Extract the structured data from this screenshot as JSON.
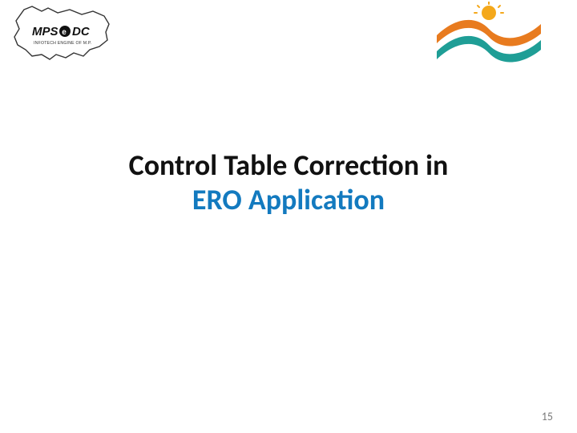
{
  "logos": {
    "left_alt": "MPSeDC logo",
    "right_alt": "Colorful wave logo"
  },
  "title": {
    "line1": "Control Table Correction in",
    "line2": "ERO Application"
  },
  "page_number": "15"
}
